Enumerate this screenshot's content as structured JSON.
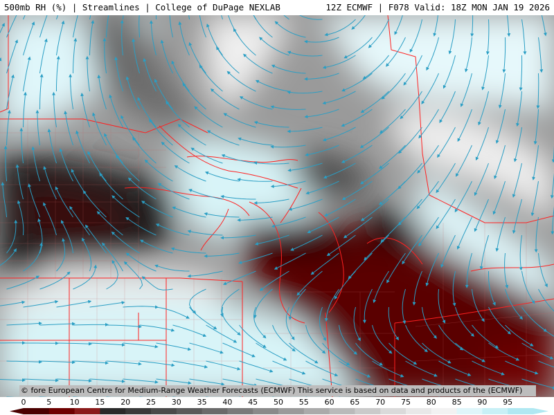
{
  "header": {
    "left": "500mb RH (%) | Streamlines | College of DuPage NEXLAB",
    "right": "12Z ECMWF | F078 Valid: 18Z MON JAN 19 2026"
  },
  "credit": "© fore European Centre for Medium-Range Weather Forecasts (ECMWF) This service is based on data and products of the (ECMWF)",
  "colorbar": {
    "ticks": [
      "0",
      "5",
      "10",
      "15",
      "20",
      "25",
      "30",
      "35",
      "40",
      "45",
      "50",
      "55",
      "60",
      "65",
      "70",
      "75",
      "80",
      "85",
      "90",
      "95"
    ],
    "colors": [
      "#4a0000",
      "#6e0000",
      "#8a1a1a",
      "#2a2a2a",
      "#3a3a3a",
      "#4a4a4a",
      "#5a5a5a",
      "#6a6a6a",
      "#7a7a7a",
      "#8a8a8a",
      "#9a9a9a",
      "#aaaaaa",
      "#bababa",
      "#cacaca",
      "#dadada",
      "#e8e8e8",
      "#f2f2f2",
      "#dff6fa",
      "#c8f0f6",
      "#b0e8f2"
    ]
  },
  "map_colors": {
    "streamline": "#2a9ec4",
    "border": "#ff2020",
    "moist": "#d8f4f8",
    "dry": "#5a0000"
  }
}
